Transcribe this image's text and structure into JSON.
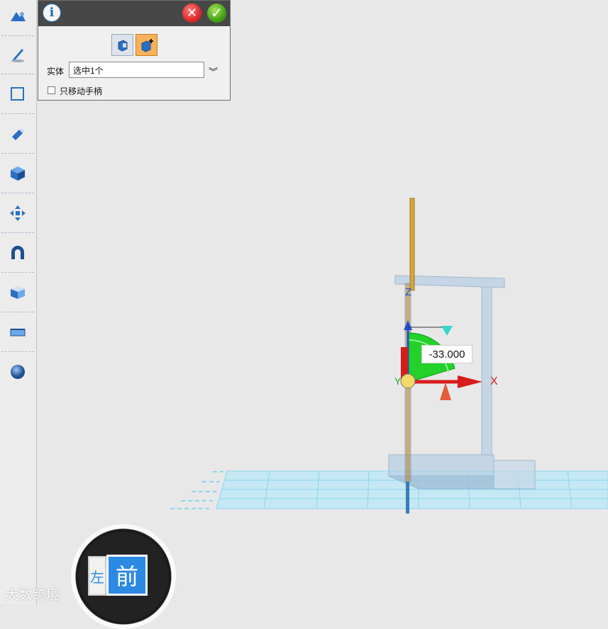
{
  "toolbar": {
    "items": [
      {
        "name": "shapes-icon"
      },
      {
        "name": "sketch-pen-icon"
      },
      {
        "name": "sketch-plane-icon"
      },
      {
        "name": "eraser-edit-icon"
      },
      {
        "name": "solid-cube-icon"
      },
      {
        "name": "move-arrows-icon"
      },
      {
        "name": "magnet-icon"
      },
      {
        "name": "cube-face-icon"
      },
      {
        "name": "measure-icon"
      },
      {
        "name": "sphere-icon"
      }
    ]
  },
  "panel": {
    "info_label": "i",
    "entity_label": "实体",
    "entity_value": "选中1个",
    "handle_only_label": "只移动手柄"
  },
  "viewport": {
    "rotation_value": "-33.000",
    "axis_x": "X",
    "axis_y": "Y",
    "axis_z": "Z"
  },
  "viewcube": {
    "front_label": "前",
    "left_label": "左"
  },
  "watermark": "大数跨境",
  "colors": {
    "accent_blue": "#2d8ae3",
    "grid_blue": "#7cd3f2",
    "gizmo_green": "#22d12a",
    "gizmo_red": "#d81c1c"
  }
}
